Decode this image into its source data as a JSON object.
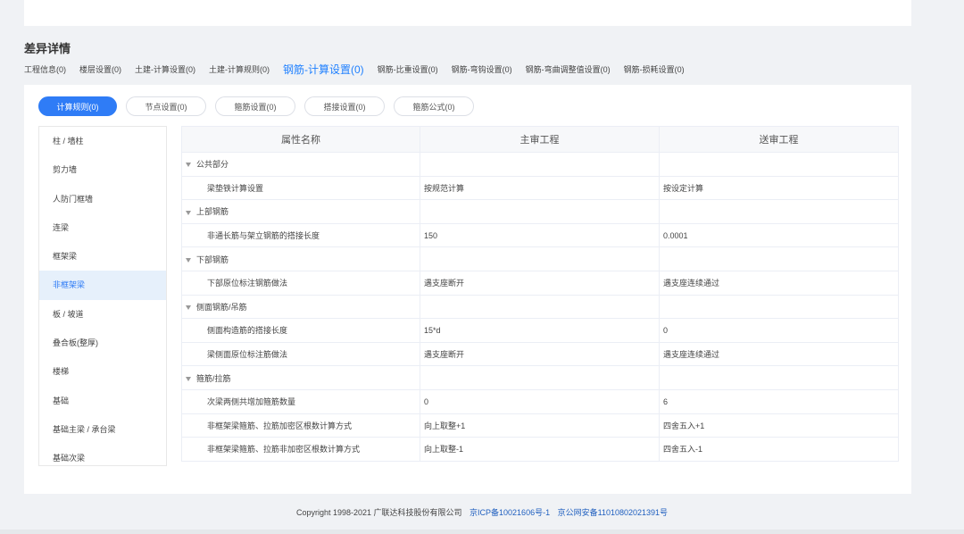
{
  "section_title": "差异详情",
  "diff_tabs": [
    {
      "label": "工程信息(0)",
      "active": false
    },
    {
      "label": "楼层设置(0)",
      "active": false
    },
    {
      "label": "土建-计算设置(0)",
      "active": false
    },
    {
      "label": "土建-计算规则(0)",
      "active": false
    },
    {
      "label": "钢筋-计算设置(0)",
      "active": true
    },
    {
      "label": "钢筋-比重设置(0)",
      "active": false
    },
    {
      "label": "钢筋-弯钩设置(0)",
      "active": false
    },
    {
      "label": "钢筋-弯曲调整值设置(0)",
      "active": false
    },
    {
      "label": "钢筋-损耗设置(0)",
      "active": false
    }
  ],
  "pills": [
    {
      "label": "计算规则(0)",
      "active": true
    },
    {
      "label": "节点设置(0)",
      "active": false
    },
    {
      "label": "箍筋设置(0)",
      "active": false
    },
    {
      "label": "搭接设置(0)",
      "active": false
    },
    {
      "label": "箍筋公式(0)",
      "active": false
    }
  ],
  "sidebar": [
    {
      "label": "柱 / 墙柱",
      "active": false
    },
    {
      "label": "剪力墙",
      "active": false
    },
    {
      "label": "人防门框墙",
      "active": false
    },
    {
      "label": "连梁",
      "active": false
    },
    {
      "label": "框架梁",
      "active": false
    },
    {
      "label": "非框架梁",
      "active": true
    },
    {
      "label": "板 / 坡道",
      "active": false
    },
    {
      "label": "叠合板(整厚)",
      "active": false
    },
    {
      "label": "楼梯",
      "active": false
    },
    {
      "label": "基础",
      "active": false
    },
    {
      "label": "基础主梁 / 承台梁",
      "active": false
    },
    {
      "label": "基础次梁",
      "active": false
    }
  ],
  "table": {
    "headers": [
      "属性名称",
      "主审工程",
      "送审工程"
    ],
    "rows": [
      {
        "type": "group",
        "name": "公共部分",
        "main": "",
        "sent": ""
      },
      {
        "type": "child",
        "name": "梁垫铁计算设置",
        "main": "按规范计算",
        "sent": "按设定计算"
      },
      {
        "type": "group",
        "name": "上部钢筋",
        "main": "",
        "sent": ""
      },
      {
        "type": "child",
        "name": "非通长筋与架立钢筋的搭接长度",
        "main": "150",
        "sent": "0.0001"
      },
      {
        "type": "group",
        "name": "下部钢筋",
        "main": "",
        "sent": ""
      },
      {
        "type": "child",
        "name": "下部原位标注钢筋做法",
        "main": "遇支座断开",
        "sent": "遇支座连续通过"
      },
      {
        "type": "group",
        "name": "侧面钢筋/吊筋",
        "main": "",
        "sent": ""
      },
      {
        "type": "child",
        "name": "侧面构造筋的搭接长度",
        "main": "15*d",
        "sent": "0"
      },
      {
        "type": "child",
        "name": "梁侧面原位标注筋做法",
        "main": "遇支座断开",
        "sent": "遇支座连续通过"
      },
      {
        "type": "group",
        "name": "箍筋/拉筋",
        "main": "",
        "sent": ""
      },
      {
        "type": "child",
        "name": "次梁两侧共增加箍筋数量",
        "main": "0",
        "sent": "6"
      },
      {
        "type": "child",
        "name": "非框架梁箍筋、拉筋加密区根数计算方式",
        "main": "向上取整+1",
        "sent": "四舍五入+1"
      },
      {
        "type": "child",
        "name": "非框架梁箍筋、拉筋非加密区根数计算方式",
        "main": "向上取整-1",
        "sent": "四舍五入-1"
      }
    ]
  },
  "footer": {
    "copyright": "Copyright 1998-2021 广联达科技股份有限公司",
    "icp": "京ICP备10021606号-1",
    "police": "京公网安备11010802021391号"
  }
}
